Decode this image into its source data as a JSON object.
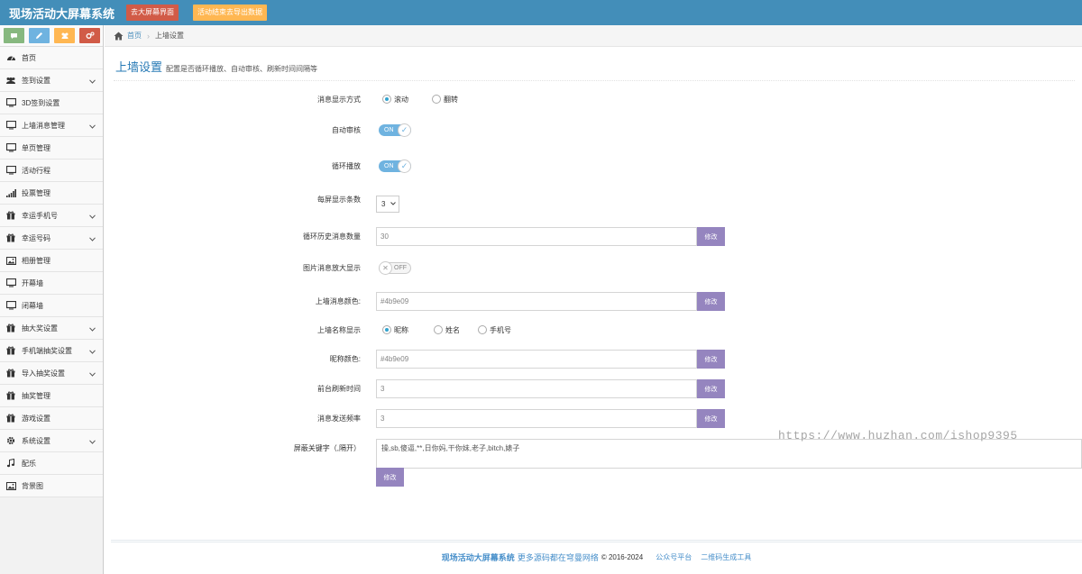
{
  "header": {
    "brand": "现场活动大屏幕系统",
    "btn_screen": "去大屏幕界面",
    "btn_export": "活动结束去导出数据"
  },
  "shortcuts": [
    {
      "icon": "comment-icon",
      "color": "#87b87f"
    },
    {
      "icon": "pencil-icon",
      "color": "#6fb3e0"
    },
    {
      "icon": "users-icon",
      "color": "#ffb752"
    },
    {
      "icon": "cogs-icon",
      "color": "#d15b47"
    }
  ],
  "sidebar": {
    "items": [
      {
        "label": "首页",
        "icon": "dashboard-icon",
        "has_children": false
      },
      {
        "label": "签到设置",
        "icon": "group-icon",
        "has_children": true
      },
      {
        "label": "3D签到设置",
        "icon": "desktop-icon",
        "has_children": false
      },
      {
        "label": "上墙消息管理",
        "icon": "desktop-icon",
        "has_children": true
      },
      {
        "label": "单页管理",
        "icon": "desktop-icon",
        "has_children": false
      },
      {
        "label": "活动行程",
        "icon": "desktop-icon",
        "has_children": false
      },
      {
        "label": "投票管理",
        "icon": "signal-icon",
        "has_children": false
      },
      {
        "label": "幸运手机号",
        "icon": "gift-icon",
        "has_children": true
      },
      {
        "label": "幸运号码",
        "icon": "gift-icon",
        "has_children": true
      },
      {
        "label": "相册管理",
        "icon": "picture-icon",
        "has_children": false
      },
      {
        "label": "开幕墙",
        "icon": "desktop-icon",
        "has_children": false
      },
      {
        "label": "闭幕墙",
        "icon": "desktop-icon",
        "has_children": false
      },
      {
        "label": "抽大奖设置",
        "icon": "gift-icon",
        "has_children": true
      },
      {
        "label": "手机端抽奖设置",
        "icon": "gift-icon",
        "has_children": true
      },
      {
        "label": "导入抽奖设置",
        "icon": "gift-icon",
        "has_children": true
      },
      {
        "label": "抽奖管理",
        "icon": "gift-icon",
        "has_children": false
      },
      {
        "label": "游戏设置",
        "icon": "gift-icon",
        "has_children": false
      },
      {
        "label": "系统设置",
        "icon": "cog-icon",
        "has_children": true
      },
      {
        "label": "配乐",
        "icon": "music-icon",
        "has_children": false
      },
      {
        "label": "背景图",
        "icon": "picture-icon",
        "has_children": false
      }
    ]
  },
  "breadcrumb": {
    "home": "首页",
    "current": "上墙设置"
  },
  "page": {
    "title": "上墙设置",
    "subtitle": "配置是否循环播放、自动审核、刷新时间间隔等"
  },
  "form": {
    "display_mode": {
      "label": "消息显示方式",
      "options": [
        "滚动",
        "翻转"
      ],
      "selected": 0
    },
    "auto_review": {
      "label": "自动审核",
      "state": "ON"
    },
    "loop_play": {
      "label": "循环播放",
      "state": "ON"
    },
    "per_screen": {
      "label": "每屏显示条数",
      "value": "3"
    },
    "history_count": {
      "label": "循环历史消息数量",
      "value": "30",
      "button": "修改"
    },
    "image_zoom": {
      "label": "图片消息放大显示",
      "state": "OFF"
    },
    "msg_color": {
      "label": "上墙消息颜色:",
      "value": "#4b9e09",
      "button": "修改"
    },
    "name_display": {
      "label": "上墙名称显示",
      "options": [
        "昵称",
        "姓名",
        "手机号"
      ],
      "selected": 0
    },
    "nick_color": {
      "label": "昵称颜色:",
      "value": "#4b9e09",
      "button": "修改"
    },
    "refresh_time": {
      "label": "前台刷新时间",
      "value": "3",
      "button": "修改"
    },
    "send_freq": {
      "label": "消息发送频率",
      "value": "3",
      "button": "修改"
    },
    "keywords": {
      "label": "屏蔽关键字（,隔开）",
      "value": "操,sb,傻逼,**,日你妈,干你妹,老子,bitch,婊子",
      "button": "修改"
    }
  },
  "watermark": "https://www.huzhan.com/ishop9395",
  "footer": {
    "brand": "现场活动大屏幕系统",
    "rest": "更多源码都在穹曼网络",
    "copy": "© 2016-2024",
    "link1": "公众号平台",
    "link2": "二维码生成工具"
  },
  "colors": {
    "topbar": "#438eb9",
    "link": "#4c8fbd",
    "title": "#2679b5",
    "button": "#9585bf",
    "toggle_on": "#6fb3e0"
  }
}
